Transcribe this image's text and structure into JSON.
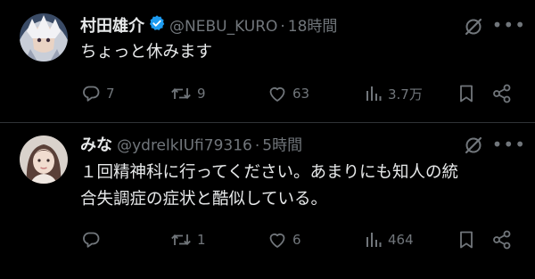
{
  "tweets": [
    {
      "display_name": "村田雄介",
      "handle": "@NEBU_KURO",
      "separator": "·",
      "time": "18時間",
      "verified": true,
      "text": "ちょっと休みます",
      "replies": "7",
      "reposts": "9",
      "likes": "63",
      "views": "3.7万"
    },
    {
      "display_name": "みな",
      "handle": "@ydrelkIUfi79316",
      "separator": "·",
      "time": "5時間",
      "verified": false,
      "text": "１回精神科に行ってください。あまりにも知人の統\n合失調症の症状と酷似している。",
      "replies": "",
      "reposts": "1",
      "likes": "6",
      "views": "464"
    }
  ],
  "icons": {
    "reply": "reply-icon",
    "repost": "repost-icon",
    "like": "like-icon",
    "views": "views-icon",
    "bookmark": "bookmark-icon",
    "share": "share-icon",
    "grok": "grok-icon",
    "more": "more-icon",
    "verified": "verified-badge-icon"
  },
  "colors": {
    "background": "#000000",
    "text": "#e7e9ea",
    "secondary": "#71767b",
    "divider": "#2f3336",
    "verified": "#1d9bf0"
  }
}
